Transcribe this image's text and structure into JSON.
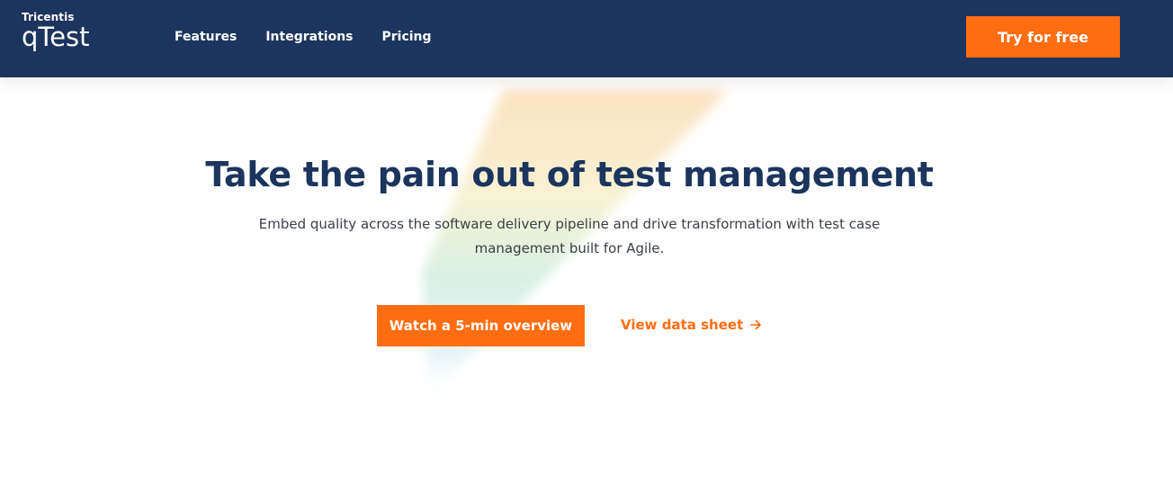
{
  "header": {
    "logo_small": "Tricentis",
    "logo_big": "qTest",
    "nav": [
      {
        "label": "Features"
      },
      {
        "label": "Integrations"
      },
      {
        "label": "Pricing"
      }
    ],
    "cta_label": "Try for free"
  },
  "hero": {
    "title": "Take the pain out of test management",
    "subtitle": "Embed quality across the software delivery pipeline and drive transformation with test case management built for Agile.",
    "primary_label": "Watch a 5-min overview",
    "secondary_label": "View data sheet",
    "secondary_icon": "arrow-right-icon"
  },
  "colors": {
    "header_bg": "#1c355e",
    "accent": "#ff6d12",
    "title": "#1c355e",
    "body_text": "#3a3f47"
  }
}
